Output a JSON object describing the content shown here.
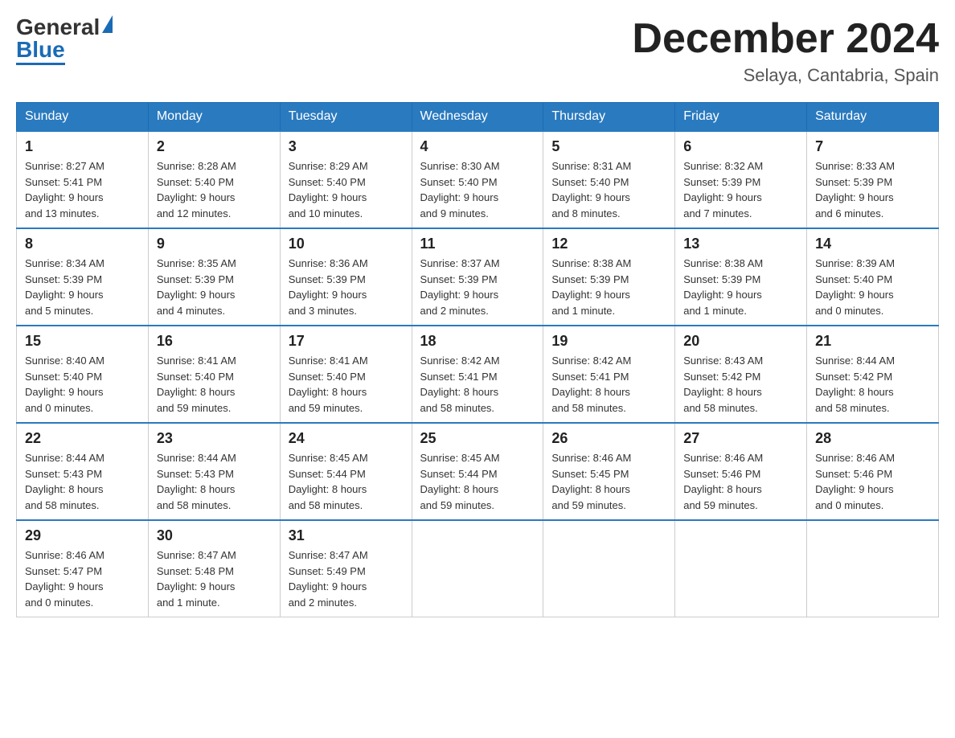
{
  "header": {
    "logo_general": "General",
    "logo_blue": "Blue",
    "month_title": "December 2024",
    "location": "Selaya, Cantabria, Spain"
  },
  "days_of_week": [
    "Sunday",
    "Monday",
    "Tuesday",
    "Wednesday",
    "Thursday",
    "Friday",
    "Saturday"
  ],
  "weeks": [
    [
      {
        "day": "1",
        "sunrise": "8:27 AM",
        "sunset": "5:41 PM",
        "daylight": "9 hours and 13 minutes."
      },
      {
        "day": "2",
        "sunrise": "8:28 AM",
        "sunset": "5:40 PM",
        "daylight": "9 hours and 12 minutes."
      },
      {
        "day": "3",
        "sunrise": "8:29 AM",
        "sunset": "5:40 PM",
        "daylight": "9 hours and 10 minutes."
      },
      {
        "day": "4",
        "sunrise": "8:30 AM",
        "sunset": "5:40 PM",
        "daylight": "9 hours and 9 minutes."
      },
      {
        "day": "5",
        "sunrise": "8:31 AM",
        "sunset": "5:40 PM",
        "daylight": "9 hours and 8 minutes."
      },
      {
        "day": "6",
        "sunrise": "8:32 AM",
        "sunset": "5:39 PM",
        "daylight": "9 hours and 7 minutes."
      },
      {
        "day": "7",
        "sunrise": "8:33 AM",
        "sunset": "5:39 PM",
        "daylight": "9 hours and 6 minutes."
      }
    ],
    [
      {
        "day": "8",
        "sunrise": "8:34 AM",
        "sunset": "5:39 PM",
        "daylight": "9 hours and 5 minutes."
      },
      {
        "day": "9",
        "sunrise": "8:35 AM",
        "sunset": "5:39 PM",
        "daylight": "9 hours and 4 minutes."
      },
      {
        "day": "10",
        "sunrise": "8:36 AM",
        "sunset": "5:39 PM",
        "daylight": "9 hours and 3 minutes."
      },
      {
        "day": "11",
        "sunrise": "8:37 AM",
        "sunset": "5:39 PM",
        "daylight": "9 hours and 2 minutes."
      },
      {
        "day": "12",
        "sunrise": "8:38 AM",
        "sunset": "5:39 PM",
        "daylight": "9 hours and 1 minute."
      },
      {
        "day": "13",
        "sunrise": "8:38 AM",
        "sunset": "5:39 PM",
        "daylight": "9 hours and 1 minute."
      },
      {
        "day": "14",
        "sunrise": "8:39 AM",
        "sunset": "5:40 PM",
        "daylight": "9 hours and 0 minutes."
      }
    ],
    [
      {
        "day": "15",
        "sunrise": "8:40 AM",
        "sunset": "5:40 PM",
        "daylight": "9 hours and 0 minutes."
      },
      {
        "day": "16",
        "sunrise": "8:41 AM",
        "sunset": "5:40 PM",
        "daylight": "8 hours and 59 minutes."
      },
      {
        "day": "17",
        "sunrise": "8:41 AM",
        "sunset": "5:40 PM",
        "daylight": "8 hours and 59 minutes."
      },
      {
        "day": "18",
        "sunrise": "8:42 AM",
        "sunset": "5:41 PM",
        "daylight": "8 hours and 58 minutes."
      },
      {
        "day": "19",
        "sunrise": "8:42 AM",
        "sunset": "5:41 PM",
        "daylight": "8 hours and 58 minutes."
      },
      {
        "day": "20",
        "sunrise": "8:43 AM",
        "sunset": "5:42 PM",
        "daylight": "8 hours and 58 minutes."
      },
      {
        "day": "21",
        "sunrise": "8:44 AM",
        "sunset": "5:42 PM",
        "daylight": "8 hours and 58 minutes."
      }
    ],
    [
      {
        "day": "22",
        "sunrise": "8:44 AM",
        "sunset": "5:43 PM",
        "daylight": "8 hours and 58 minutes."
      },
      {
        "day": "23",
        "sunrise": "8:44 AM",
        "sunset": "5:43 PM",
        "daylight": "8 hours and 58 minutes."
      },
      {
        "day": "24",
        "sunrise": "8:45 AM",
        "sunset": "5:44 PM",
        "daylight": "8 hours and 58 minutes."
      },
      {
        "day": "25",
        "sunrise": "8:45 AM",
        "sunset": "5:44 PM",
        "daylight": "8 hours and 59 minutes."
      },
      {
        "day": "26",
        "sunrise": "8:46 AM",
        "sunset": "5:45 PM",
        "daylight": "8 hours and 59 minutes."
      },
      {
        "day": "27",
        "sunrise": "8:46 AM",
        "sunset": "5:46 PM",
        "daylight": "8 hours and 59 minutes."
      },
      {
        "day": "28",
        "sunrise": "8:46 AM",
        "sunset": "5:46 PM",
        "daylight": "9 hours and 0 minutes."
      }
    ],
    [
      {
        "day": "29",
        "sunrise": "8:46 AM",
        "sunset": "5:47 PM",
        "daylight": "9 hours and 0 minutes."
      },
      {
        "day": "30",
        "sunrise": "8:47 AM",
        "sunset": "5:48 PM",
        "daylight": "9 hours and 1 minute."
      },
      {
        "day": "31",
        "sunrise": "8:47 AM",
        "sunset": "5:49 PM",
        "daylight": "9 hours and 2 minutes."
      },
      null,
      null,
      null,
      null
    ]
  ],
  "labels": {
    "sunrise": "Sunrise:",
    "sunset": "Sunset:",
    "daylight": "Daylight:"
  }
}
